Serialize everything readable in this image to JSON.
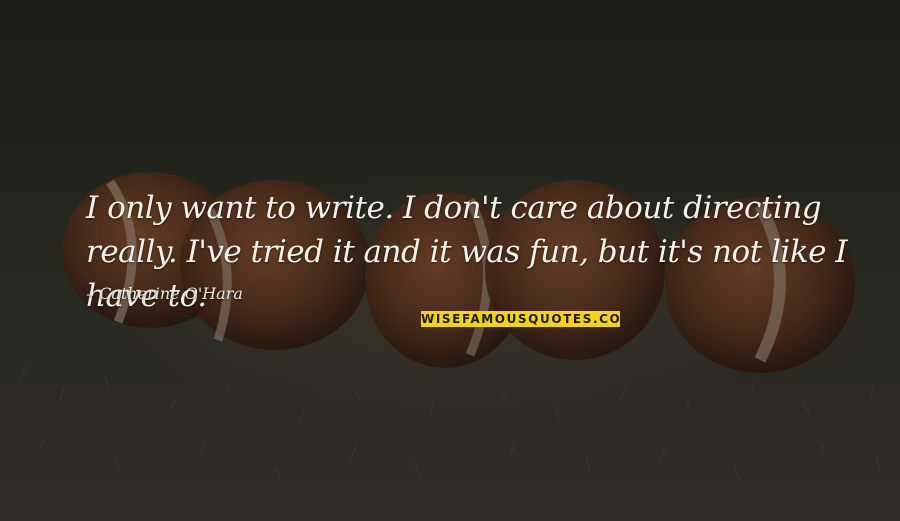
{
  "quote": {
    "text": "I only want to write. I don't care about directing really. I've tried it and it was fun, but it's not like I have to.",
    "author": "Catherine O'Hara"
  },
  "brand": {
    "watermark": "WISEFAMOUSQUOTES.COM"
  },
  "background": {
    "description_icon": "footballs-on-grass-image"
  },
  "colors": {
    "quote_text": "#f4f1ea",
    "watermark_bg": "#f2d21a",
    "watermark_text": "#1a1a10"
  }
}
